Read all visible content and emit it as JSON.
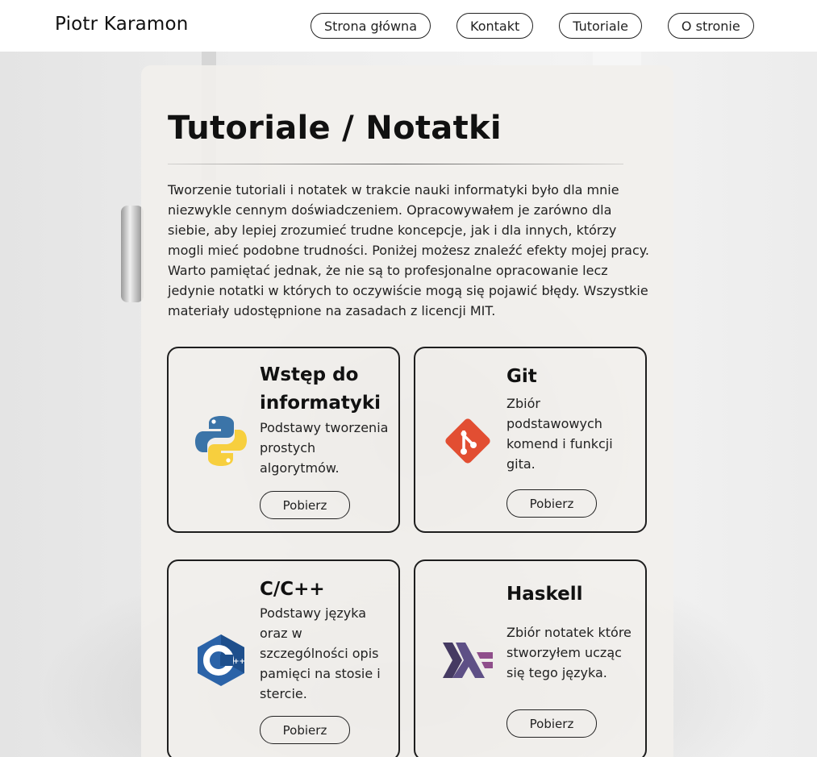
{
  "header": {
    "brand": "Piotr Karamon",
    "nav": [
      {
        "label": "Strona główna"
      },
      {
        "label": "Kontakt"
      },
      {
        "label": "Tutoriale"
      },
      {
        "label": "O stronie"
      }
    ]
  },
  "main": {
    "title": "Tutoriale / Notatki",
    "intro": "Tworzenie tutoriali i notatek w trakcie nauki informatyki było dla mnie niezwykle cennym doświadczeniem. Opracowywałem je zarówno dla siebie, aby lepiej zrozumieć trudne koncepcje, jak i dla innych, którzy mogli mieć podobne trudności. Poniżej możesz znaleźć efekty mojej pracy. Warto pamiętać jednak, że nie są to profesjonalne opracowanie lecz jedynie notatki w których to oczywiście mogą się pojawić błędy. Wszystkie materiały udostępnione na zasadach z licencji MIT.",
    "tiles": [
      {
        "title": "Wstęp do informatyki",
        "desc": "Podstawy tworzenia prostych algorytmów.",
        "button": "Pobierz",
        "icon": "python-icon"
      },
      {
        "title": "Git",
        "desc": "Zbiór podstawowych komend i funkcji gita.",
        "button": "Pobierz",
        "icon": "git-icon"
      },
      {
        "title": "C/C++",
        "desc": "Podstawy języka oraz w szczególności opis pamięci na stosie i stercie.",
        "button": "Pobierz",
        "icon": "cpp-icon"
      },
      {
        "title": "Haskell",
        "desc": "Zbiór notatek które stworzyłem ucząc się tego języka.",
        "button": "Pobierz",
        "icon": "haskell-icon"
      }
    ]
  },
  "colors": {
    "accent_border": "#1e1e1e",
    "card_bg": "#f2f0ec",
    "git_red": "#e24e32",
    "python_blue": "#3b74a8",
    "python_yellow": "#f7cf3e",
    "cpp_blue": "#2b63a8",
    "haskell_purple": "#5d4f85"
  }
}
